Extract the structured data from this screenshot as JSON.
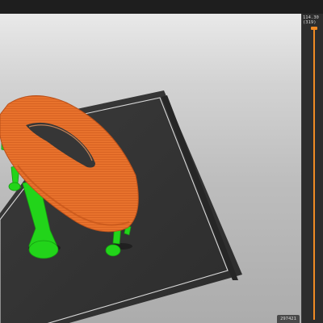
{
  "layer_slider": {
    "top_height": "114.30",
    "top_layer": "(319)",
    "bottom_readout": "297421"
  },
  "colors": {
    "model": "#e8722c",
    "supports": "#22d41a",
    "bed": "#333333",
    "slider_accent": "#f08a24"
  }
}
